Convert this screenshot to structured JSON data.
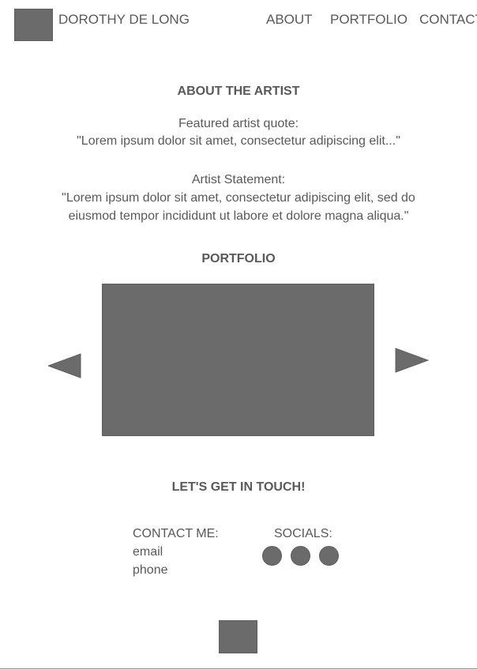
{
  "header": {
    "site_title": "DOROTHY DE LONG",
    "nav": {
      "about": "ABOUT",
      "portfolio": "PORTFOLIO",
      "contact": "CONTACT"
    }
  },
  "about": {
    "heading": "ABOUT THE ARTIST",
    "quote_label": "Featured artist quote:",
    "quote_text": "\"Lorem ipsum dolor sit amet, consectetur adipiscing elit...\"",
    "statement_label": "Artist Statement:",
    "statement_line1": "\"Lorem ipsum dolor sit amet, consectetur adipiscing elit, sed do",
    "statement_line2": "eiusmod tempor incididunt ut labore et dolore magna aliqua.\""
  },
  "portfolio": {
    "heading": "PORTFOLIO",
    "prev_icon": "triangle-left-icon",
    "next_icon": "triangle-right-icon"
  },
  "contact": {
    "heading": "LET'S GET IN TOUCH!",
    "contact_label": "CONTACT ME:",
    "email": "email",
    "phone": "phone",
    "socials_label": "SOCIALS:",
    "social_icons": [
      "circle-icon",
      "circle-icon",
      "circle-icon"
    ]
  },
  "colors": {
    "placeholder_fill": "#6b6b6b",
    "text": "#595959",
    "background": "#ffffff"
  }
}
